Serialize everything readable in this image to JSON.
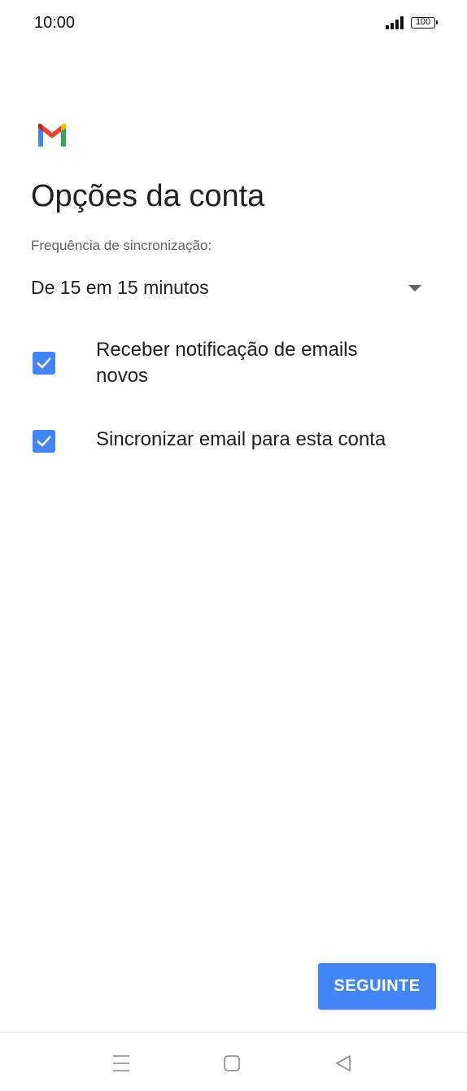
{
  "status_bar": {
    "time": "10:00",
    "battery": "100"
  },
  "app": {
    "logo_icon": "gmail-logo-icon",
    "colors": {
      "red": "#EA4335",
      "blue": "#4285F4",
      "green": "#34A853",
      "yellow": "#FBBC05",
      "dark_red": "#C5221F"
    }
  },
  "main": {
    "title": "Opções da conta",
    "sync_label": "Frequência de sincronização:",
    "sync_value": "De 15 em 15 minutos",
    "options": [
      {
        "label": "Receber notificação de emails novos",
        "checked": true
      },
      {
        "label": "Sincronizar email para esta conta",
        "checked": true
      }
    ]
  },
  "footer": {
    "next_label": "SEGUINTE",
    "accent": "#4285F4"
  },
  "nav_bar": {
    "icons": [
      "menu-icon",
      "home-icon",
      "back-icon"
    ]
  }
}
